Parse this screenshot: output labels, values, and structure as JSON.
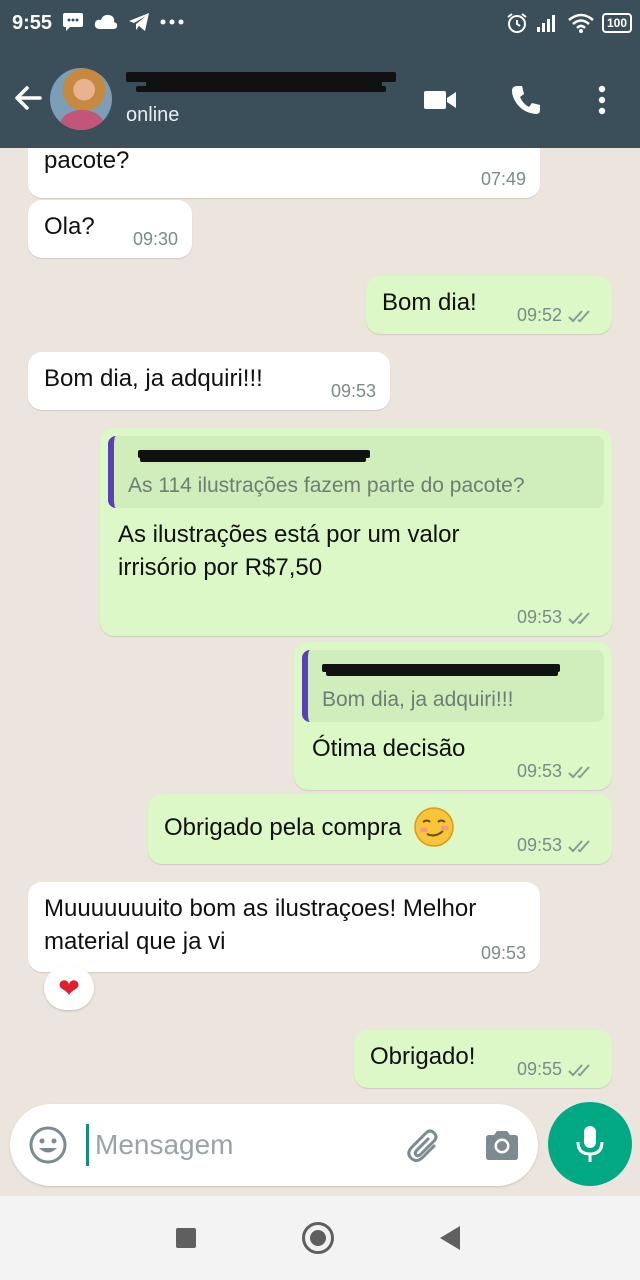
{
  "status_bar": {
    "time": "9:55",
    "battery": "100"
  },
  "header": {
    "status": "online"
  },
  "messages": [
    {
      "text": "pacote?",
      "time": "07:49"
    },
    {
      "text": "Ola?",
      "time": "09:30"
    },
    {
      "text": "Bom dia!",
      "time": "09:52"
    },
    {
      "text": "Bom dia, ja adquiri!!!",
      "time": "09:53"
    },
    {
      "quote": "As 114 ilustrações fazem parte do pacote?",
      "text": "As ilustrações está por um valor irrisório por R$7,50",
      "time": "09:53"
    },
    {
      "quote": "Bom dia, ja adquiri!!!",
      "text": "Ótima decisão",
      "time": "09:53"
    },
    {
      "text": "Obrigado pela compra",
      "time": "09:53"
    },
    {
      "text": "Muuuuuuuito bom as ilustraçoes! Melhor material que ja vi",
      "time": "09:53",
      "reaction": "❤"
    },
    {
      "text": "Obrigado!",
      "time": "09:55"
    }
  ],
  "input": {
    "placeholder": "Mensagem"
  },
  "icons": {
    "emoji": "emoji-icon",
    "attach": "paperclip-icon",
    "camera": "camera-icon",
    "mic": "mic-icon"
  },
  "colors": {
    "header": "#3a4f5a",
    "outgoing": "#dcf8c6",
    "incoming": "#ffffff",
    "accent": "#00a884",
    "quote_bar": "#5b3fb5"
  }
}
